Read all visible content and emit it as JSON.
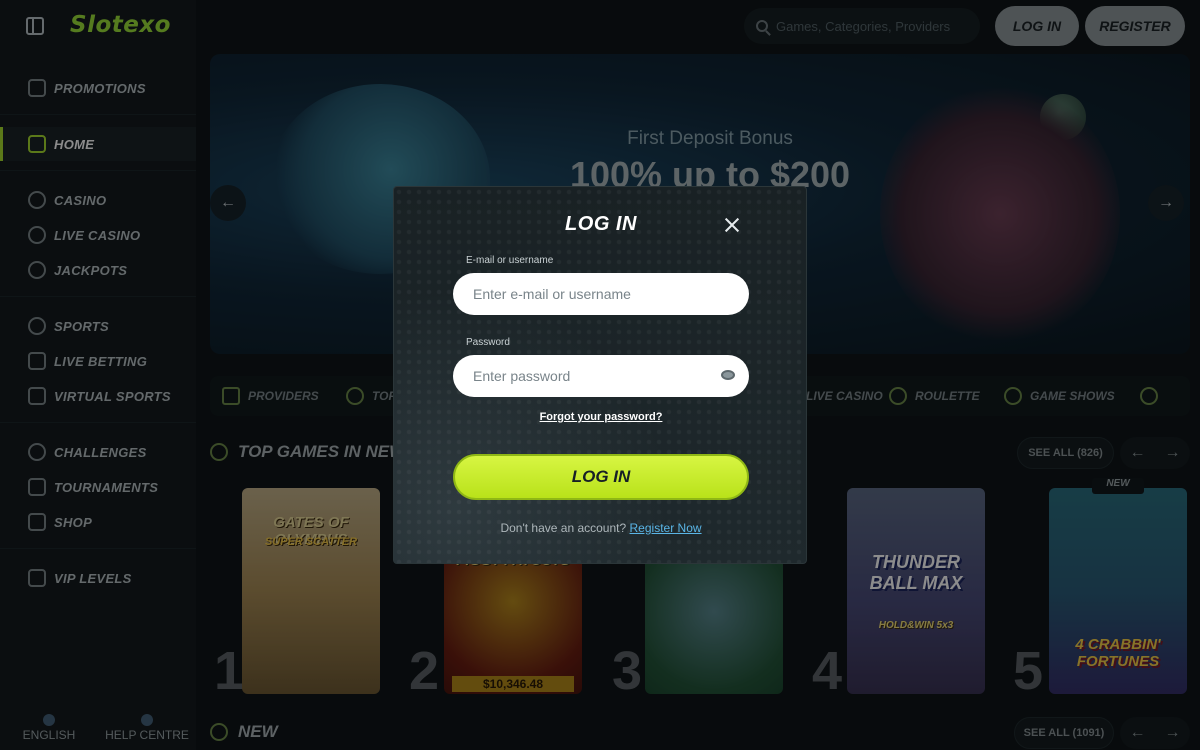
{
  "brand": {
    "logo": "Slotexo"
  },
  "sidebar": {
    "items": [
      {
        "label": "PROMOTIONS",
        "icon": "gift-icon"
      },
      {
        "label": "HOME",
        "icon": "home-icon",
        "active": true
      },
      {
        "label": "CASINO",
        "icon": "casino-chip-icon"
      },
      {
        "label": "LIVE CASINO",
        "icon": "live-casino-icon"
      },
      {
        "label": "JACKPOTS",
        "icon": "jackpot-icon"
      },
      {
        "label": "SPORTS",
        "icon": "football-icon"
      },
      {
        "label": "LIVE BETTING",
        "icon": "live-betting-icon"
      },
      {
        "label": "VIRTUAL SPORTS",
        "icon": "virtual-sports-icon"
      },
      {
        "label": "CHALLENGES",
        "icon": "challenges-icon"
      },
      {
        "label": "TOURNAMENTS",
        "icon": "trophy-icon"
      },
      {
        "label": "SHOP",
        "icon": "shop-icon"
      },
      {
        "label": "VIP LEVELS",
        "icon": "diamond-icon"
      }
    ],
    "language": "ENGLISH",
    "help": "HELP CENTRE"
  },
  "topbar": {
    "search_placeholder": "Games, Categories, Providers",
    "login": "LOG IN",
    "register": "REGISTER"
  },
  "banner": {
    "subtitle": "First Deposit Bonus",
    "title": "100% up to $200"
  },
  "categories": [
    {
      "label": "PROVIDERS"
    },
    {
      "label": "TOP"
    },
    {
      "label": "LIVE CASINO"
    },
    {
      "label": "ROULETTE"
    },
    {
      "label": "GAME SHOWS"
    }
  ],
  "sections": {
    "top_games": {
      "title": "TOP GAMES IN NEW",
      "see_all": "SEE ALL (826)"
    },
    "new": {
      "title": "NEW",
      "see_all": "SEE ALL (1091)"
    }
  },
  "games": [
    {
      "rank": "1",
      "title": "GATES OF OLYMPUS",
      "subtitle": "SUPER SCATTER"
    },
    {
      "rank": "2",
      "title": "PIGGY PAYOUTS",
      "price": "$10,346.48"
    },
    {
      "rank": "3",
      "title": ""
    },
    {
      "rank": "4",
      "title": "THUNDER BALL MAX",
      "subtitle": "HOLD&WIN 5x3"
    },
    {
      "rank": "5",
      "title": "4 CRABBIN' FORTUNES",
      "badge": "NEW"
    }
  ],
  "login_modal": {
    "title": "LOG IN",
    "email_label": "E-mail or username",
    "email_placeholder": "Enter e-mail or username",
    "password_label": "Password",
    "password_placeholder": "Enter password",
    "forgot": "Forgot your password?",
    "submit": "LOG IN",
    "no_account": "Don't have an account?",
    "register_link": "Register Now"
  },
  "colors": {
    "accent": "#b9e21a",
    "background": "#0f1518",
    "link": "#5ab5e6"
  }
}
